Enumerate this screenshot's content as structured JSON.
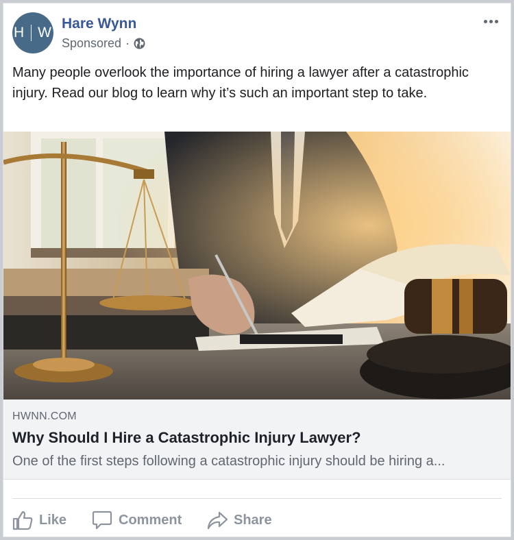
{
  "post": {
    "avatar_initials_left": "H",
    "avatar_initials_right": "W",
    "page_name": "Hare Wynn",
    "sponsored_label": "Sponsored",
    "separator": "·",
    "body_text": "Many people overlook the importance of hiring a lawyer after a catastrophic injury. Read our blog to learn why it’s such an important step to take."
  },
  "link_preview": {
    "domain": "HWNN.COM",
    "headline": "Why Should I Hire a Catastrophic Injury Lawyer?",
    "description": "One of the first steps following a catastrophic injury should be hiring a..."
  },
  "actions": {
    "like": "Like",
    "comment": "Comment",
    "share": "Share"
  },
  "icons": {
    "globe": "globe-icon",
    "more": "more-options-icon",
    "like": "thumbs-up-icon",
    "comment": "comment-bubble-icon",
    "share": "share-arrow-icon"
  },
  "colors": {
    "page_name": "#385898",
    "avatar": "#466a87",
    "muted_text": "#606770",
    "action_text": "#8d949e",
    "link_box_bg": "#f2f3f5"
  }
}
